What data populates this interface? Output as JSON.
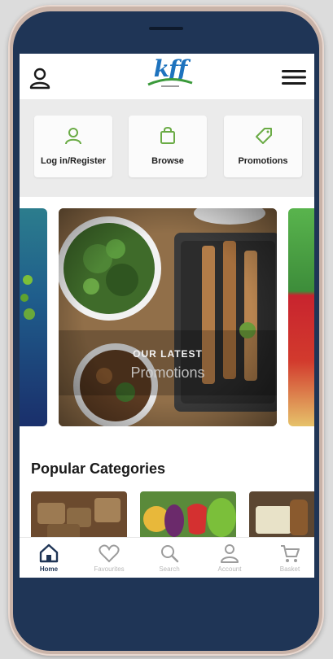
{
  "header": {
    "logo_text": "kff"
  },
  "quick_actions": [
    {
      "label": "Log in/Register",
      "icon": "user-icon"
    },
    {
      "label": "Browse",
      "icon": "bag-icon"
    },
    {
      "label": "Promotions",
      "icon": "tag-icon"
    }
  ],
  "carousel": {
    "title": "OUR LATEST",
    "subtitle": "Promotions"
  },
  "popular": {
    "title": "Popular Categories"
  },
  "nav": [
    {
      "label": "Home",
      "icon": "home-icon",
      "active": true
    },
    {
      "label": "Favourites",
      "icon": "heart-icon",
      "active": false
    },
    {
      "label": "Search",
      "icon": "search-icon",
      "active": false
    },
    {
      "label": "Account",
      "icon": "account-icon",
      "active": false
    },
    {
      "label": "Basket",
      "icon": "cart-icon",
      "active": false
    }
  ],
  "colors": {
    "brand_blue": "#1e73be",
    "brand_green": "#3b9a3b",
    "accent_green": "#6aab45",
    "phone_navy": "#1f3556"
  }
}
